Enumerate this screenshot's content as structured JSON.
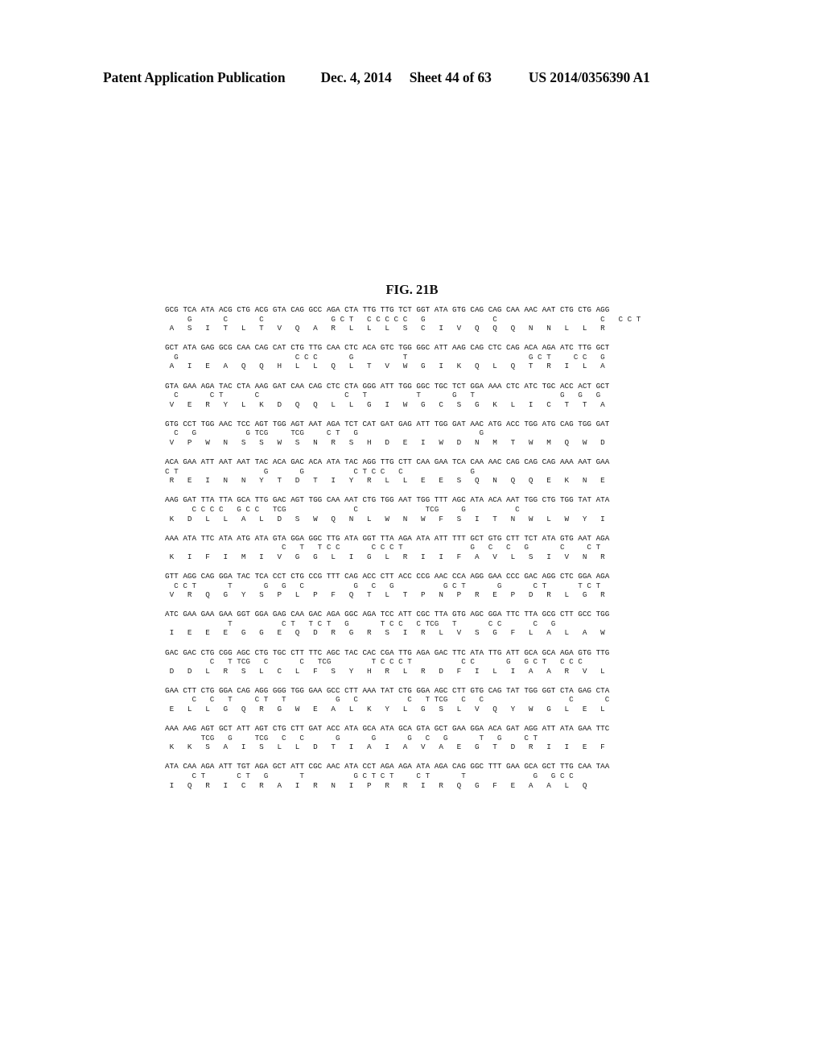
{
  "header": {
    "publication": "Patent Application Publication",
    "date": "Dec. 4, 2014",
    "sheet": "Sheet 44 of 63",
    "doc_number": "US 2014/0356390 A1"
  },
  "figure": {
    "label": "FIG. 21B"
  },
  "sequence": {
    "blocks": [
      {
        "nucleotide": "GCG TCA ATA ACG CTG ACG GTA CAG GCC AGA CTA TTG TTG TCT GGT ATA GTG CAG CAG CAA AAC AAT CTG CTG AGG",
        "variant": "     G       C       C               G C T   C C C C C   G               C                       C   C C T",
        "protein": " A   S   I   T   L   T   V   Q   A   R   L   L   L   S   C   I   V   Q   Q   Q   N   N   L   L   R"
      },
      {
        "nucleotide": "GCT ATA GAG GCG CAA CAG CAT CTG TTG CAA CTC ACA GTC TGG GGC ATT AAG CAG CTC CAG ACA AGA ATC TTG GCT",
        "variant": "  G                          C C C       G           T                           G C T     C C   G",
        "protein": " A   I   E   A   Q   Q   H   L   L   Q   L   T   V   W   G   I   K   Q   L   Q   T   R   I   L   A"
      },
      {
        "nucleotide": "GTA GAA AGA TAC CTA AAG GAT CAA CAG CTC CTA GGG ATT TGG GGC TGC TCT GGA AAA CTC ATC TGC ACC ACT GCT",
        "variant": "  C       C T       C                   C   T           T       G   T                   G   G   G",
        "protein": " V   E   R   Y   L   K   D   Q   Q   L   L   G   I   W   G   C   S   G   K   L   I   C   T   T   A"
      },
      {
        "nucleotide": "GTG CCT TGG AAC TCC AGT TGG AGT AAT AGA TCT CAT GAT GAG ATT TGG GAT AAC ATG ACC TGG ATG CAG TGG GAT",
        "variant": "  C   G           G TCG     TCG     C T   G                           G",
        "protein": " V   P   W   N   S   S   W   S   N   R   S   H   D   E   I   W   D   N   M   T   W   M   Q   W   D"
      },
      {
        "nucleotide": "ACA GAA ATT AAT AAT TAC ACA GAC ACA ATA TAC AGG TTG CTT CAA GAA TCA CAA AAC CAG CAG CAG AAA AAT GAA",
        "variant": "C T                   G       G           C T C C   C               G",
        "protein": " R   E   I   N   N   Y   T   D   T   I   Y   R   L   L   E   E   S   Q   N   Q   Q   E   K   N   E"
      },
      {
        "nucleotide": "AAG GAT TTA TTA GCA TTG GAC AGT TGG CAA AAT CTG TGG AAT TGG TTT AGC ATA ACA AAT TGG CTG TGG TAT ATA",
        "variant": "      C C C C   G C C   TCG               C               TCG     G           C",
        "protein": " K   D   L   L   A   L   D   S   W   Q   N   L   W   N   W   F   S   I   T   N   W   L   W   Y   I"
      },
      {
        "nucleotide": "AAA ATA TTC ATA ATG ATA GTA GGA GGC TTG ATA GGT TTA AGA ATA ATT TTT GCT GTG CTT TCT ATA GTG AAT AGA",
        "variant": "                          C   T   T C C       C C C T               G   C   C   G       C     C T",
        "protein": " K   I   F   I   M   I   V   G   G   L   I   G   L   R   I   I   F   A   V   L   S   I   V   N   R"
      },
      {
        "nucleotide": "GTT AGG CAG GGA TAC TCA CCT CTG CCG TTT CAG ACC CTT ACC CCG AAC CCA AGG GAA CCC GAC AGG CTC GGA AGA",
        "variant": "  C C T       T       G   G   C           G   C   G           G C T       G       C T       T C T",
        "protein": " V   R   Q   G   Y   S   P   L   P   F   Q   T   L   T   P   N   P   R   E   P   D   R   L   G   R"
      },
      {
        "nucleotide": "ATC GAA GAA GAA GGT GGA GAG CAA GAC AGA GGC AGA TCC ATT CGC TTA GTG AGC GGA TTC TTA GCG CTT GCC TGG",
        "variant": "              T           C T   T C T   G       T C C   C TCG   T       C C       C   G",
        "protein": " I   E   E   E   G   G   E   Q   D   R   G   R   S   I   R   L   V   S   G   F   L   A   L   A   W"
      },
      {
        "nucleotide": "GAC GAC CTG CGG AGC CTG TGC CTT TTC AGC TAC CAC CGA TTG AGA GAC TTC ATA TTG ATT GCA GCA AGA GTG TTG",
        "variant": "          C   T TCG   C       C   TCG         T C C C T           C C       G   G C T   C C C",
        "protein": " D   D   L   R   S   L   C   L   F   S   Y   H   R   L   R   D   F   I   L   I   A   A   R   V   L"
      },
      {
        "nucleotide": "GAA CTT CTG GGA CAG AGG GGG TGG GAA GCC CTT AAA TAT CTG GGA AGC CTT GTG CAG TAT TGG GGT CTA GAG CTA",
        "variant": "      C   C   T     C T   T           G   C           C   T TCG   C   C                   C       C",
        "protein": " E   L   L   G   Q   R   G   W   E   A   L   K   Y   L   G   S   L   V   Q   Y   W   G   L   E   L"
      },
      {
        "nucleotide": "AAA AAG AGT GCT ATT AGT CTG CTT GAT ACC ATA GCA ATA GCA GTA GCT GAA GGA ACA GAT AGG ATT ATA GAA TTC",
        "variant": "        TCG   G     TCG   C   C       G       G       G   C   G       T   G     C T",
        "protein": " K   K   S   A   I   S   L   L   D   T   I   A   I   A   V   A   E   G   T   D   R   I   I   E   F"
      },
      {
        "nucleotide": "ATA CAA AGA ATT TGT AGA GCT ATT CGC AAC ATA CCT AGA AGA ATA AGA CAG GGC TTT GAA GCA GCT TTG CAA TAA",
        "variant": "      C T       C T   G       T           G C T C T     C T       T               G   G C C",
        "protein": " I   Q   R   I   C   R   A   I   R   N   I   P   R   R   I   R   Q   G   F   E   A   A   L   Q"
      }
    ]
  }
}
